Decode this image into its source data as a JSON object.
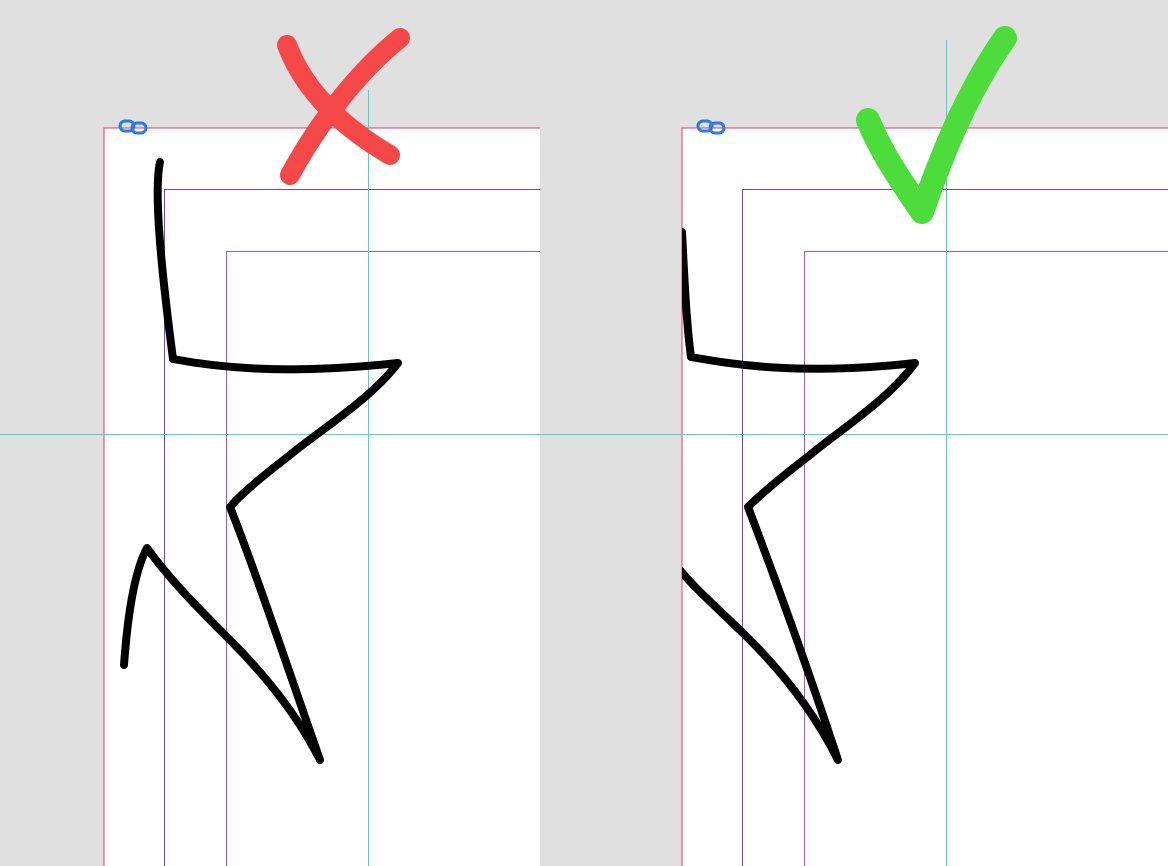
{
  "comparison": {
    "left_panel": {
      "verdict": "incorrect",
      "mark_icon": "cross-mark-icon",
      "mark_color": "#f54848",
      "link_icon": "link-chain-icon"
    },
    "right_panel": {
      "verdict": "correct",
      "mark_icon": "check-mark-icon",
      "mark_color": "#4cdc3c",
      "link_icon": "link-chain-icon"
    }
  },
  "colors": {
    "pasteboard": "#e0e0e0",
    "page": "#ffffff",
    "bleed_guide": "#e03a78",
    "margin_guide": "#7a3fd0",
    "column_guide": "#b44be0",
    "ruler_guide": "#3fd6e0",
    "stroke": "#000000",
    "link_badge": "#2c7be5"
  }
}
